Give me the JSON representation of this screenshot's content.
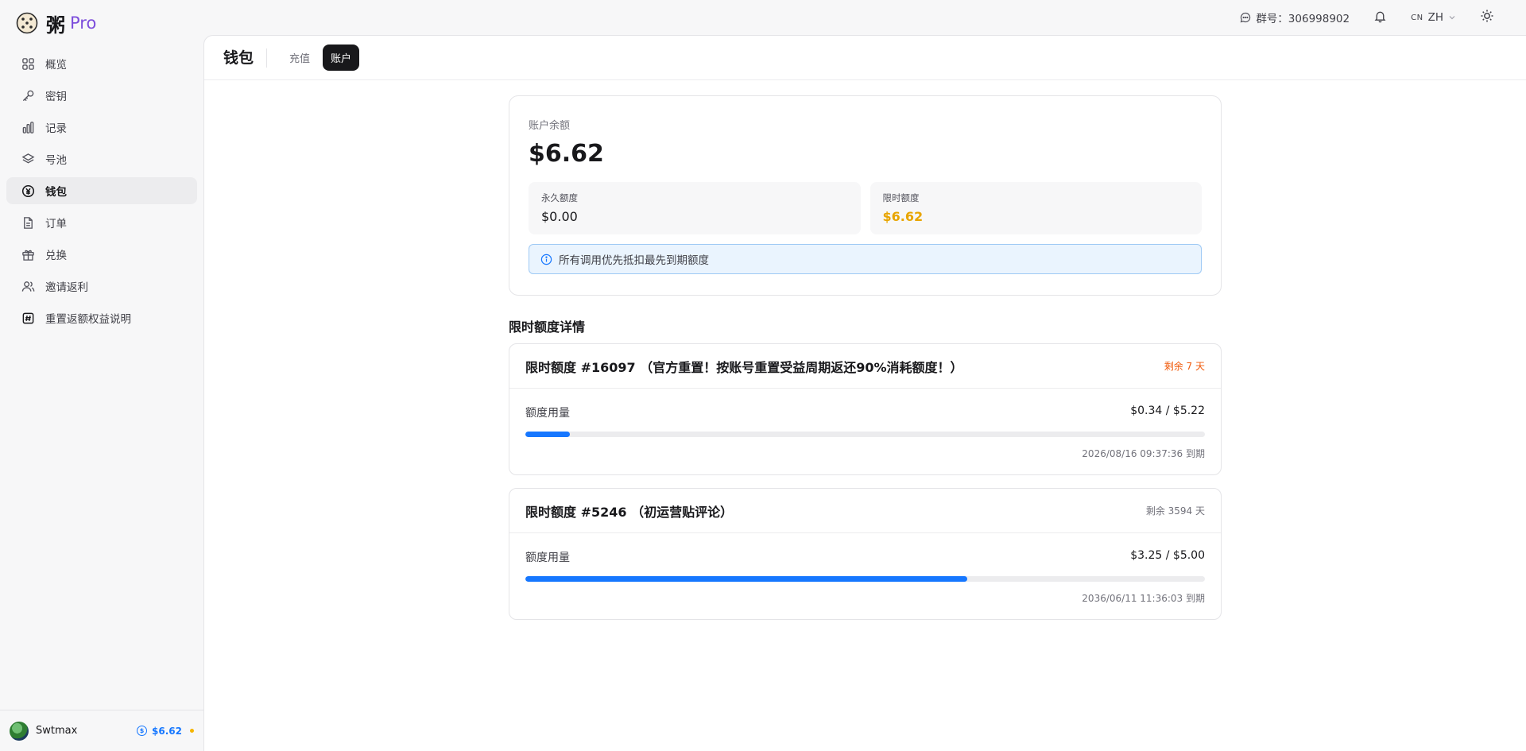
{
  "brand": {
    "name": "粥",
    "suffix": "Pro"
  },
  "nav": [
    {
      "label": "概览",
      "icon": "grid-icon",
      "active": false
    },
    {
      "label": "密钥",
      "icon": "key-icon",
      "active": false
    },
    {
      "label": "记录",
      "icon": "bar-chart-icon",
      "active": false
    },
    {
      "label": "号池",
      "icon": "layers-icon",
      "active": false
    },
    {
      "label": "钱包",
      "icon": "yen-icon",
      "active": true
    },
    {
      "label": "订单",
      "icon": "file-icon",
      "active": false
    },
    {
      "label": "兑换",
      "icon": "gift-icon",
      "active": false
    },
    {
      "label": "邀请返利",
      "icon": "users-icon",
      "active": false
    },
    {
      "label": "重置返额权益说明",
      "icon": "hash-icon",
      "active": false
    }
  ],
  "user": {
    "name": "Swtmax",
    "balance": "$6.62"
  },
  "topbar": {
    "group": "群号：306998902",
    "lang_code": "CN",
    "lang": "ZH"
  },
  "page": {
    "title": "钱包",
    "tabs": [
      "充值",
      "账户"
    ],
    "active_tab": 1
  },
  "balance": {
    "label": "账户余额",
    "amount": "$6.62",
    "permanent_label": "永久额度",
    "permanent_value": "$0.00",
    "limited_label": "限时额度",
    "limited_value": "$6.62",
    "notice": "所有调用优先抵扣最先到期额度"
  },
  "section_title": "限时额度详情",
  "quotas": [
    {
      "title": "限时额度 #16097 （官方重置！按账号重置受益周期返还90%消耗额度！）",
      "remaining": "剩余 7 天",
      "usage_label": "额度用量",
      "usage": "$0.34 / $5.22",
      "progress": 0.065,
      "expires": "2026/08/16 09:37:36 到期",
      "warn": true
    },
    {
      "title": "限时额度 #5246 （初运营贴评论）",
      "remaining": "剩余 3594 天",
      "usage_label": "额度用量",
      "usage": "$3.25 / $5.00",
      "progress": 0.65,
      "expires": "2036/06/11 11:36:03 到期",
      "warn": false
    }
  ]
}
